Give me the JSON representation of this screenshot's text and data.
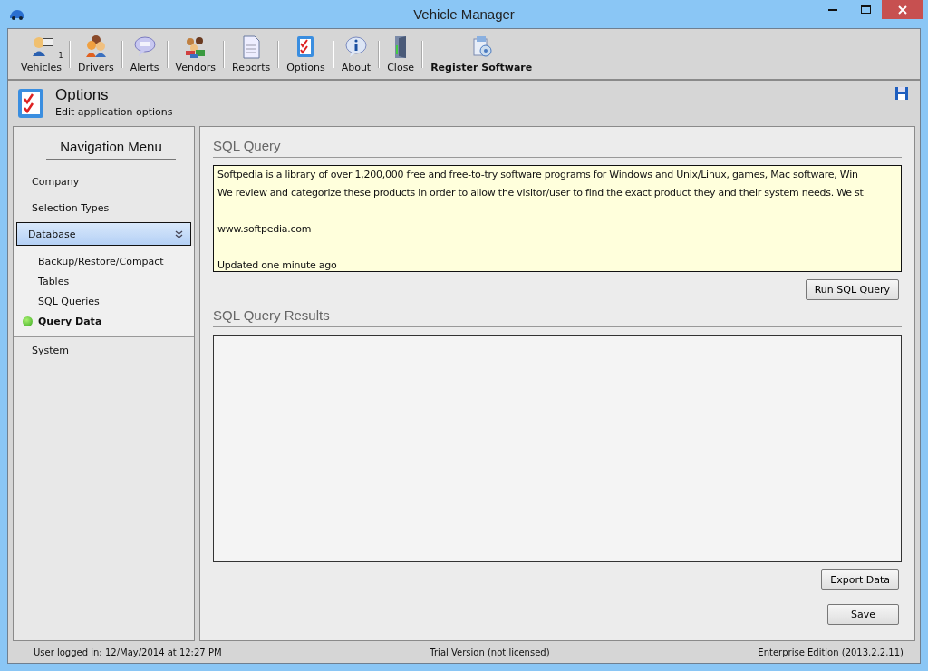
{
  "window": {
    "title": "Vehicle Manager"
  },
  "toolbar": [
    {
      "kind": "vehicles",
      "label": "Vehicles",
      "badge": "1",
      "bold": false
    },
    {
      "kind": "drivers",
      "label": "Drivers",
      "bold": false
    },
    {
      "kind": "alerts",
      "label": "Alerts",
      "bold": false
    },
    {
      "kind": "vendors",
      "label": "Vendors",
      "bold": false
    },
    {
      "kind": "reports",
      "label": "Reports",
      "bold": false
    },
    {
      "kind": "options",
      "label": "Options",
      "bold": false
    },
    {
      "kind": "about",
      "label": "About",
      "bold": false
    },
    {
      "kind": "close",
      "label": "Close",
      "bold": false
    },
    {
      "kind": "register",
      "label": "Register Software",
      "bold": true
    }
  ],
  "header": {
    "title": "Options",
    "subtitle": "Edit application options"
  },
  "navigation": {
    "title": "Navigation Menu",
    "items": [
      {
        "label": "Company",
        "selected": false
      },
      {
        "label": "Selection Types",
        "selected": false
      },
      {
        "label": "Database",
        "selected": true,
        "expanded": true,
        "children": [
          {
            "label": "Backup/Restore/Compact",
            "selected": false
          },
          {
            "label": "Tables",
            "selected": false
          },
          {
            "label": "SQL Queries",
            "selected": false
          },
          {
            "label": "Query Data",
            "selected": true
          }
        ]
      },
      {
        "label": "System",
        "selected": false
      }
    ]
  },
  "sql_query": {
    "title": "SQL Query",
    "lines": [
      {
        "text": "Softpedia is a library of over 1,200,000 free and free-to-try software programs for Windows and Unix/Linux, games, Mac software, Win",
        "gap_before": false
      },
      {
        "text": "We review and categorize these products in order to allow the visitor/user to find the exact product they and their system needs. We st",
        "gap_before": false
      },
      {
        "text": "www.softpedia.com",
        "gap_before": true
      },
      {
        "text": "Updated one minute ago",
        "gap_before": true
      }
    ],
    "button": "Run SQL Query"
  },
  "results": {
    "title": "SQL Query Results",
    "button": "Export Data"
  },
  "save_button": "Save",
  "status_bar": {
    "user": "User logged in:  12/May/2014 at 12:27 PM",
    "license": "Trial Version (not licensed)",
    "edition": "Enterprise Edition (2013.2.2.11)"
  }
}
